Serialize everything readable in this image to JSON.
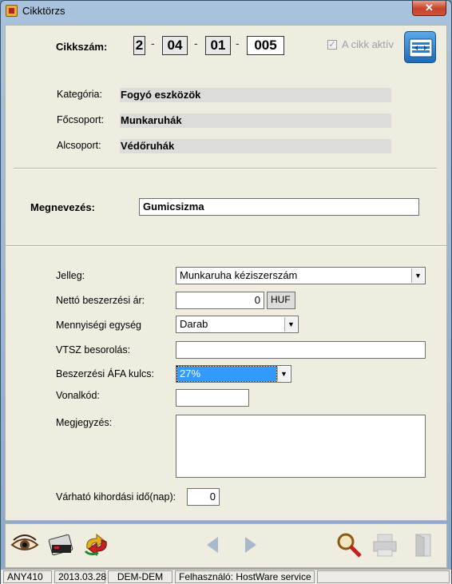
{
  "window": {
    "title": "Cikktörzs",
    "close_glyph": "✕"
  },
  "header": {
    "code_label": "Cikkszám:",
    "code_segments": [
      "2",
      "04",
      "01",
      "005"
    ],
    "separator": "-",
    "active_checkbox_label": "A cikk aktív",
    "active_checked": true
  },
  "classification": {
    "category_label": "Kategória:",
    "category_value": "Fogyó eszközök",
    "main_group_label": "Főcsoport:",
    "main_group_value": "Munkaruhák",
    "sub_group_label": "Alcsoport:",
    "sub_group_value": "Védőruhák"
  },
  "name": {
    "label": "Megnevezés:",
    "value": "Gumicsizma"
  },
  "details": {
    "type_label": "Jelleg:",
    "type_value": "Munkaruha kéziszerszám",
    "net_price_label": "Nettó beszerzési ár:",
    "net_price_value": "0",
    "currency": "HUF",
    "unit_label": "Mennyiségi egység",
    "unit_value": "Darab",
    "vtsz_label": "VTSZ besorolás:",
    "vtsz_value": "",
    "vat_label": "Beszerzési ÁFA kulcs:",
    "vat_value": "27%",
    "barcode_label": "Vonalkód:",
    "barcode_value": "",
    "note_label": "Megjegyzés:",
    "note_value": "",
    "issue_time_label": "Várható kihordási idő(nap):",
    "issue_time_value": "0"
  },
  "toolbar": {
    "icons": [
      "eye-icon",
      "card-reader-icon",
      "refresh-arrows-icon",
      "prev-arrow-icon",
      "next-arrow-icon",
      "search-icon",
      "printer-icon",
      "exit-door-icon"
    ]
  },
  "status": {
    "code": "ANY410",
    "date": "2013.03.28",
    "db": "DEM-DEM",
    "user": "Felhasználó: HostWare service"
  },
  "colors": {
    "selection": "#3399ff",
    "panel": "#efede0",
    "header_button": "#2a7fc8"
  }
}
